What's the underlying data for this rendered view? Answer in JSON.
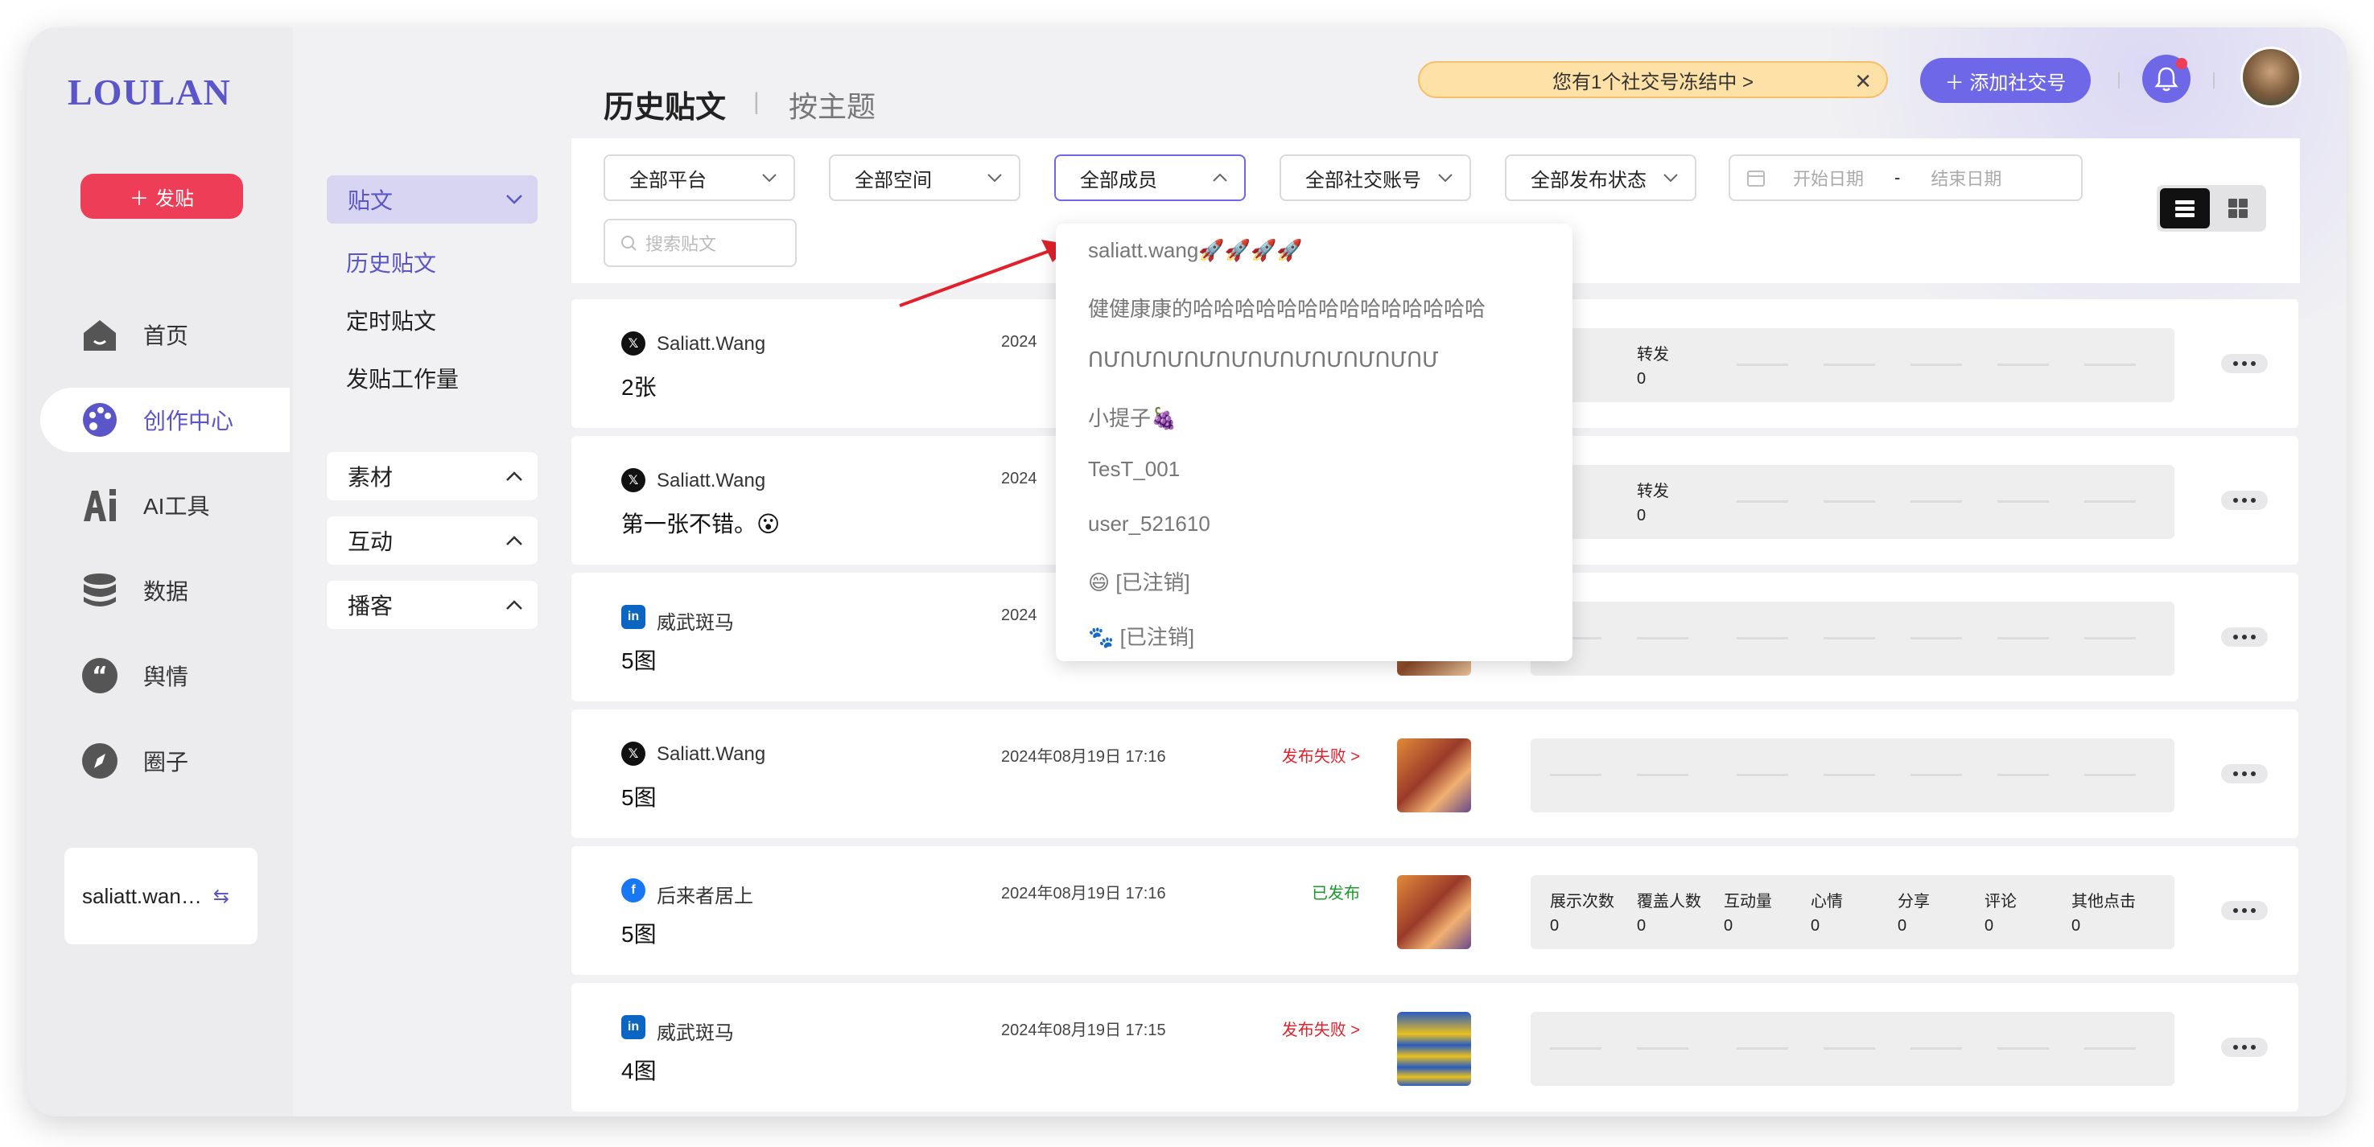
{
  "app": {
    "logo": "LOULAN"
  },
  "leftnav": {
    "post_button": "发贴",
    "items": [
      {
        "label": "首页",
        "icon": "home-icon"
      },
      {
        "label": "创作中心",
        "icon": "palette-icon"
      },
      {
        "label": "AI工具",
        "icon": "ai-icon"
      },
      {
        "label": "数据",
        "icon": "database-icon"
      },
      {
        "label": "舆情",
        "icon": "quote-icon"
      },
      {
        "label": "圈子",
        "icon": "compass-icon"
      }
    ],
    "user": "saliatt.wan…"
  },
  "subnav": {
    "posts_group": "贴文",
    "links": [
      "历史贴文",
      "定时贴文",
      "发贴工作量"
    ],
    "groups": [
      "素材",
      "互动",
      "播客"
    ]
  },
  "header": {
    "title": "历史贴文",
    "subtitle": "按主题",
    "notice": "您有1个社交号冻结中 >",
    "add_button": "添加社交号"
  },
  "filters": {
    "platform": "全部平台",
    "space": "全部空间",
    "member": "全部成员",
    "account": "全部社交账号",
    "status": "全部发布状态",
    "date_start": "开始日期",
    "date_sep": "-",
    "date_end": "结束日期",
    "search_placeholder": "搜索贴文"
  },
  "member_dropdown": [
    "saliatt.wang🚀🚀🚀🚀",
    "健健康康的哈哈哈哈哈哈哈哈哈哈哈哈哈哈",
    "ՈՄՈՄՈՄՈՄՈՄՈՄՈՄՈՄՈՄՈՄՈՄ",
    "小提子🍇",
    "TesT_001",
    "user_521610",
    "😄 [已注销]",
    "🐾 [已注销]"
  ],
  "posts": [
    {
      "platform": "x",
      "account": "Saliatt.Wang",
      "text": "2张",
      "time": "2024",
      "status": "",
      "stats": [
        {
          "label": "转发",
          "value": "0"
        }
      ]
    },
    {
      "platform": "x",
      "account": "Saliatt.Wang",
      "text": "第一张不错。😮",
      "time": "2024",
      "status": "",
      "stats": [
        {
          "label": "转发",
          "value": "0"
        }
      ]
    },
    {
      "platform": "linkedin",
      "account": "威武斑马",
      "text": "5图",
      "time": "2024",
      "status": "",
      "stats": []
    },
    {
      "platform": "x",
      "account": "Saliatt.Wang",
      "text": "5图",
      "time": "2024年08月19日 17:16",
      "status": "发布失败 >",
      "stats": []
    },
    {
      "platform": "facebook",
      "account": "后来者居上",
      "text": "5图",
      "time": "2024年08月19日 17:16",
      "status": "已发布",
      "stats": [
        {
          "label": "展示次数",
          "value": "0"
        },
        {
          "label": "覆盖人数",
          "value": "0"
        },
        {
          "label": "互动量",
          "value": "0"
        },
        {
          "label": "心情",
          "value": "0"
        },
        {
          "label": "分享",
          "value": "0"
        },
        {
          "label": "评论",
          "value": "0"
        },
        {
          "label": "其他点击",
          "value": "0"
        }
      ]
    },
    {
      "platform": "linkedin",
      "account": "威武斑马",
      "text": "4图",
      "time": "2024年08月19日 17:15",
      "status": "发布失败 >",
      "stats": []
    }
  ],
  "colors": {
    "accent": "#5a55c8",
    "button": "#6e67e8",
    "danger": "#ee3d56",
    "success": "#1a9a2a",
    "fail": "#e0202a"
  }
}
